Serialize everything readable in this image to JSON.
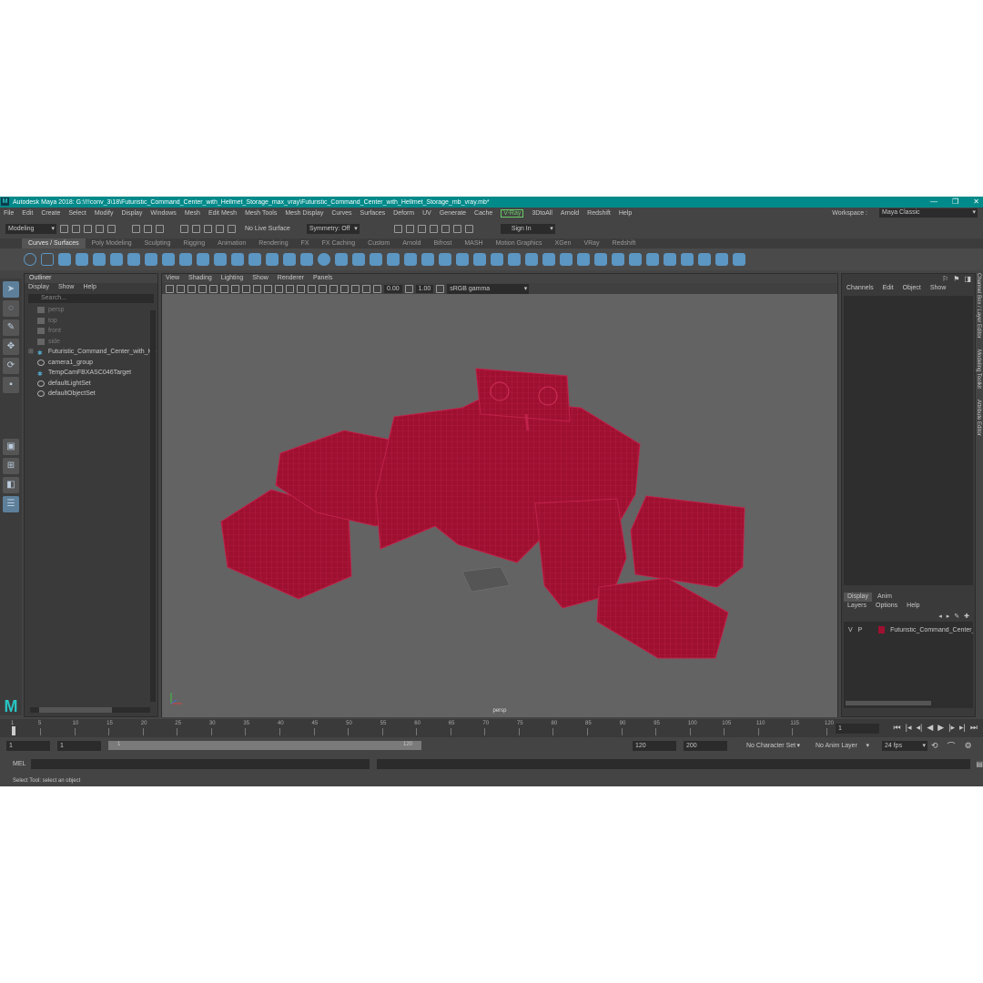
{
  "window": {
    "title": "Autodesk Maya 2018: G:\\!!!conv_3\\18\\Futuristic_Command_Center_with_Hellmet_Storage_max_vray\\Futuristic_Command_Center_with_Hellmet_Storage_mb_vray.mb*",
    "logo": "M"
  },
  "menu": {
    "items": [
      "File",
      "Edit",
      "Create",
      "Select",
      "Modify",
      "Display",
      "Windows",
      "Mesh",
      "Edit Mesh",
      "Mesh Tools",
      "Mesh Display",
      "Curves",
      "Surfaces",
      "Deform",
      "UV",
      "Generate",
      "Cache",
      "V-Ray",
      "3DtoAll",
      "Arnold",
      "Redshift",
      "Help"
    ],
    "workspace_label": "Workspace :",
    "workspace_value": "Maya Classic"
  },
  "status_line": {
    "mode": "Modeling",
    "live_surface": "No Live Surface",
    "symmetry": "Symmetry: Off",
    "sign_in": "Sign In"
  },
  "shelf": {
    "tabs": [
      "Curves / Surfaces",
      "Poly Modeling",
      "Sculpting",
      "Rigging",
      "Animation",
      "Rendering",
      "FX",
      "FX Caching",
      "Custom",
      "Arnold",
      "Bifrost",
      "MASH",
      "Motion Graphics",
      "XGen",
      "VRay",
      "Redshift"
    ],
    "active_tab": "Curves / Surfaces"
  },
  "outliner": {
    "title": "Outliner",
    "menu": [
      "Display",
      "Show",
      "Help"
    ],
    "search_placeholder": "Search...",
    "items": [
      {
        "label": "persp",
        "dim": true,
        "icon": "camera-icon"
      },
      {
        "label": "top",
        "dim": true,
        "icon": "camera-icon"
      },
      {
        "label": "front",
        "dim": true,
        "icon": "camera-icon"
      },
      {
        "label": "side",
        "dim": true,
        "icon": "camera-icon"
      },
      {
        "label": "Futuristic_Command_Center_with_He",
        "dim": false,
        "icon": "group-icon"
      },
      {
        "label": "camera1_group",
        "dim": false,
        "icon": "group-icon"
      },
      {
        "label": "TempCamFBXASC046Target",
        "dim": false,
        "icon": "locator-icon"
      },
      {
        "label": "defaultLightSet",
        "dim": false,
        "icon": "set-icon"
      },
      {
        "label": "defaultObjectSet",
        "dim": false,
        "icon": "set-icon"
      }
    ]
  },
  "viewport": {
    "menu": [
      "View",
      "Shading",
      "Lighting",
      "Show",
      "Renderer",
      "Panels"
    ],
    "exposure": "0.00",
    "gamma": "1.00",
    "color_space": "sRGB gamma",
    "camera_label": "persp",
    "wire_color": "#9e1030"
  },
  "channel_box": {
    "menu": [
      "Channels",
      "Edit",
      "Object",
      "Show"
    ],
    "side_tabs": [
      "Channel Box / Layer Editor",
      "Modeling Toolkit",
      "Attribute Editor"
    ]
  },
  "layers": {
    "tabs": [
      "Display",
      "Anim"
    ],
    "menu": [
      "Layers",
      "Options",
      "Help"
    ],
    "rows": [
      {
        "v": "V",
        "p": "P",
        "name": "Futuristic_Command_Center_wi"
      }
    ]
  },
  "time_slider": {
    "ticks": [
      "1",
      "5",
      "10",
      "15",
      "20",
      "25",
      "30",
      "35",
      "40",
      "45",
      "50",
      "55",
      "60",
      "65",
      "70",
      "75",
      "80",
      "85",
      "90",
      "95",
      "100",
      "105",
      "110",
      "115",
      "120"
    ],
    "current_frame": "1"
  },
  "range_slider": {
    "start": "1",
    "anim_start": "1",
    "range_start_label": "1",
    "range_end_label": "120",
    "end": "120",
    "anim_end": "200",
    "character_set": "No Character Set",
    "anim_layer": "No Anim Layer",
    "fps": "24 fps"
  },
  "command_line": {
    "label": "MEL"
  },
  "help_line": {
    "text": "Select Tool: select an object"
  }
}
